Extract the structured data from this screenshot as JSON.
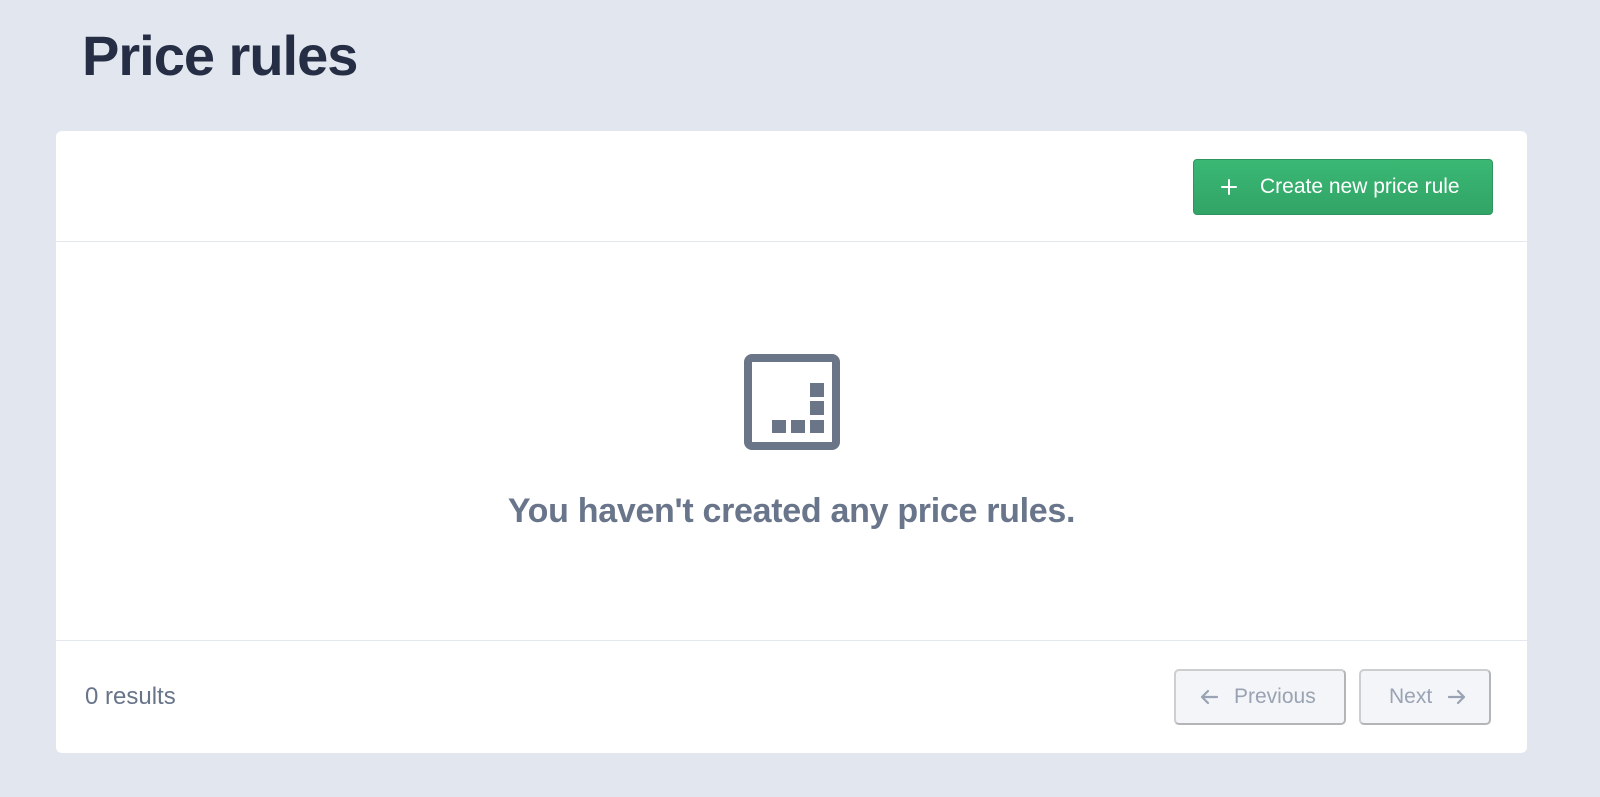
{
  "page": {
    "title": "Price rules"
  },
  "header": {
    "create_button_label": "Create new price rule",
    "create_button_icon": "plus-icon"
  },
  "empty_state": {
    "icon": "chart-box-icon",
    "message": "You haven't created any price rules."
  },
  "footer": {
    "results_text": "0 results",
    "previous_label": "Previous",
    "previous_icon": "arrow-left-icon",
    "next_label": "Next",
    "next_icon": "arrow-right-icon"
  },
  "colors": {
    "background": "#e2e7ef",
    "card": "#ffffff",
    "primary_button": "#35a96b",
    "title_text": "#262e45",
    "muted_text": "#69758a"
  }
}
